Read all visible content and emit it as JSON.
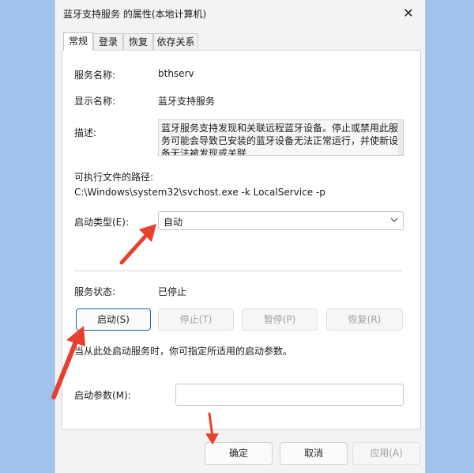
{
  "window": {
    "title": "蓝牙支持服务 的属性(本地计算机)",
    "close_glyph": "✕"
  },
  "tabs": [
    {
      "label": "常规",
      "active": true
    },
    {
      "label": "登录"
    },
    {
      "label": "恢复"
    },
    {
      "label": "依存关系"
    }
  ],
  "general": {
    "service_name_label": "服务名称:",
    "service_name": "bthserv",
    "display_name_label": "显示名称:",
    "display_name": "蓝牙支持服务",
    "description_label": "描述:",
    "description": "蓝牙服务支持发现和关联远程蓝牙设备。停止或禁用此服务可能会导致已安装的蓝牙设备无法正常运行，并使新设备无法被发现或关联",
    "path_label": "可执行文件的路径:",
    "path": "C:\\Windows\\system32\\svchost.exe -k LocalService -p",
    "startup_type_label": "启动类型(E):",
    "startup_type": "自动",
    "status_label": "服务状态:",
    "status": "已停止",
    "buttons": {
      "start": "启动(S)",
      "stop": "停止(T)",
      "pause": "暂停(P)",
      "resume": "恢复(R)"
    },
    "hint": "当从此处启动服务时，你可指定所适用的启动参数。",
    "params_label": "启动参数(M):",
    "params_value": ""
  },
  "footer": {
    "ok": "确定",
    "cancel": "取消",
    "apply": "应用(A)"
  },
  "colors": {
    "arrow": "#e8402f",
    "background": "#9fc3ee",
    "primary_border": "#1f5fbf"
  }
}
